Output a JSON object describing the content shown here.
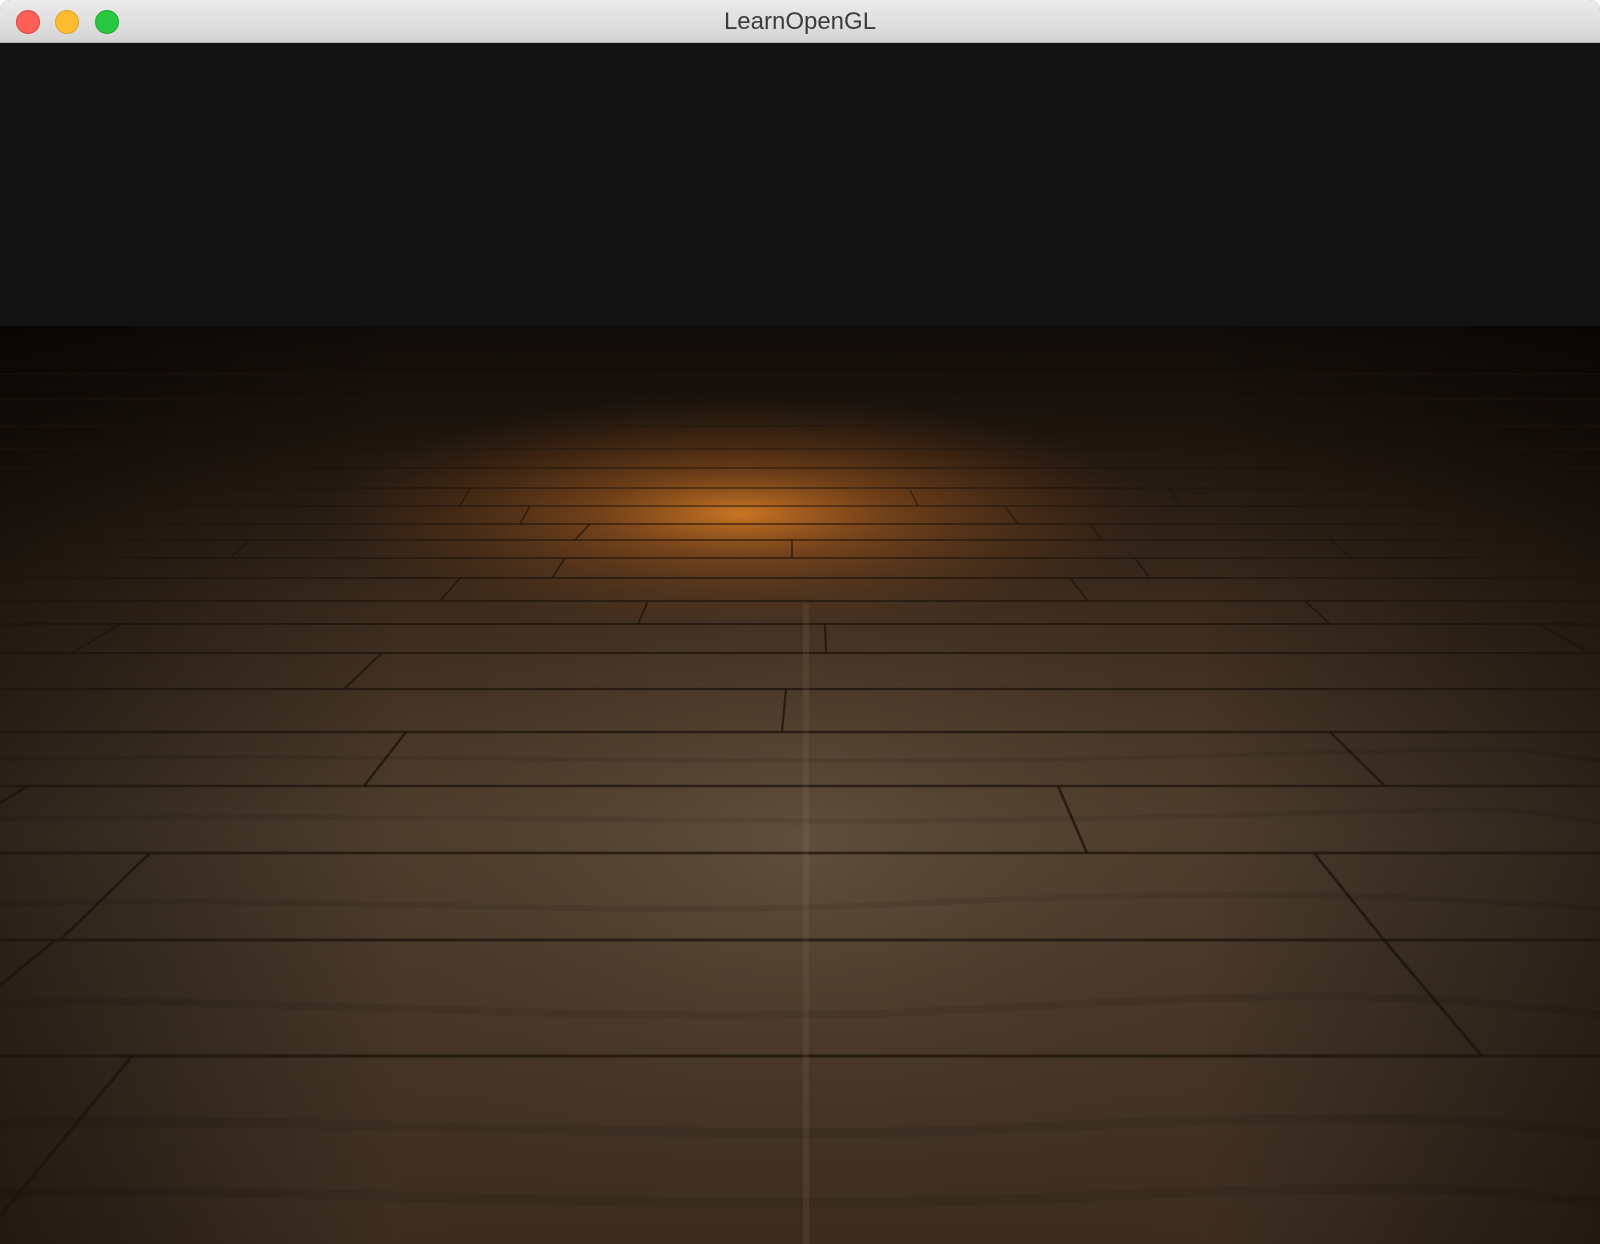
{
  "window": {
    "title": "LearnOpenGL"
  },
  "traffic_lights": [
    {
      "action": "close",
      "color": "#ff5f57"
    },
    {
      "action": "minimize",
      "color": "#febc2e"
    },
    {
      "action": "zoom",
      "color": "#28c840"
    }
  ],
  "scene": {
    "clear_color": "#131313",
    "floor_color": "#5b4331",
    "light_color": "#c8741e",
    "floor_texture": "wood-planks"
  }
}
